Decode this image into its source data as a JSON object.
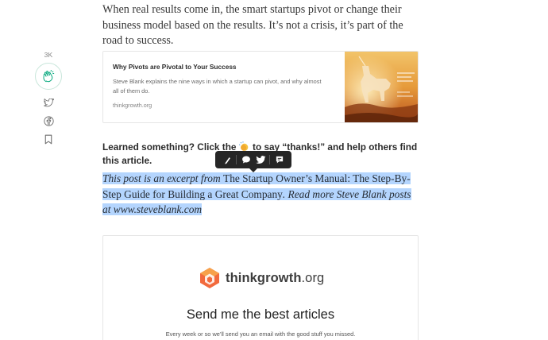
{
  "article": {
    "intro": "When real results come in, the smart startups pivot or change their business model based on the results. It’s not a crisis, it’s part of the road to success.",
    "cta_before": "Learned something? Click the ",
    "cta_after": " to say “thanks!” and help others find this article.",
    "excerpt_part1": "This post is an excerpt from ",
    "excerpt_book": "The Startup Owner’s Manual: The Step-By-Step Guide for Building a Great Company",
    "excerpt_part2": ". Read more Steve Blank posts at www.steveblank.com"
  },
  "rail": {
    "clap_count": "3K",
    "icons": [
      "clap-icon",
      "twitter-icon",
      "facebook-icon",
      "bookmark-icon"
    ]
  },
  "embed": {
    "title": "Why Pivots are Pivotal to Your Success",
    "description": "Steve Blank explains the nine ways in which a startup can pivot, and why almost all of them do.",
    "domain": "thinkgrowth.org"
  },
  "toolbar": {
    "icons": [
      "highlight-icon",
      "response-icon",
      "twitter-share-icon",
      "private-note-icon"
    ]
  },
  "signup": {
    "brand_main": "thinkgrowth",
    "brand_suffix": ".org",
    "title": "Send me the best articles",
    "subtitle": "Every week or so we’ll send you an email with the good stuff you missed."
  },
  "colors": {
    "selection": "#b4d5fe",
    "clap_green": "#03a87c",
    "toolbar_bg": "#262626",
    "brand_orange": "#f26a3d"
  }
}
